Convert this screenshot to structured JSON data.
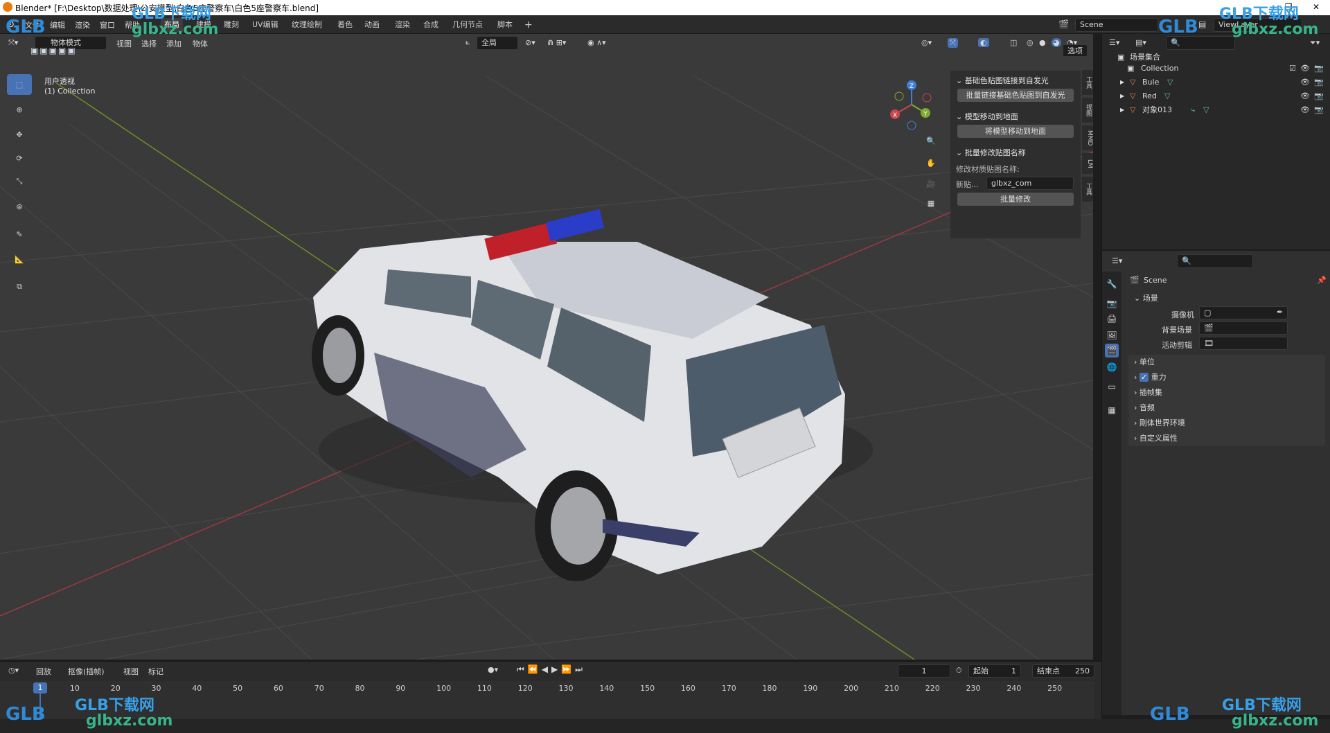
{
  "window": {
    "title": "Blender* [F:\\Desktop\\数据处理\\公安模型\\白色5座警察车\\白色5座警察车.blend]",
    "min": "—",
    "max": "❐",
    "close": "✕"
  },
  "menu": [
    "文件",
    "编辑",
    "渲染",
    "窗口",
    "帮助"
  ],
  "workspaces": [
    "布局",
    "建模",
    "雕刻",
    "UV编辑",
    "纹理绘制",
    "着色",
    "动画",
    "渲染",
    "合成",
    "几何节点",
    "脚本"
  ],
  "workspace_add": "+",
  "scene": {
    "label": "Scene"
  },
  "viewlayer": {
    "label": "ViewLayer"
  },
  "viewport": {
    "mode": "物体模式",
    "menus": [
      "视图",
      "选择",
      "添加",
      "物体"
    ],
    "transform_orientation": "全局",
    "options_label": "选项",
    "perspective_label": "用户透视",
    "collection_label": "(1) Collection",
    "gizmo": {
      "z": "Z",
      "x": "X",
      "y": "Y"
    }
  },
  "npanel": {
    "sections": [
      {
        "title": "基础色贴图链接到自发光",
        "button": "批量链接基础色贴图到自发光"
      },
      {
        "title": "模型移动到地面",
        "button": "将模型移动到地面"
      },
      {
        "title": "批量修改贴图名称",
        "subtitle": "修改材质贴图名称:",
        "field_label": "新贴...",
        "field_value": "glbxz_com",
        "button": "批量修改"
      }
    ],
    "tabs": [
      "工具",
      "视图",
      "MMD",
      "LM",
      "工具"
    ]
  },
  "outliner": {
    "root": "场景集合",
    "collection": "Collection",
    "objects": [
      "Bule",
      "Red",
      "对象013"
    ]
  },
  "properties": {
    "header": "Scene",
    "section_scene": "场景",
    "fields": [
      {
        "label": "摄像机",
        "value": ""
      },
      {
        "label": "背景场景",
        "value": ""
      },
      {
        "label": "活动剪辑",
        "value": ""
      }
    ],
    "panels": [
      "单位",
      "重力",
      "插帧集",
      "音频",
      "刚体世界环境",
      "自定义属性"
    ]
  },
  "timeline": {
    "menus": [
      "回放",
      "抠像(插帧)",
      "视图",
      "标记"
    ],
    "current_frame": "1",
    "start_label": "起始",
    "start_value": "1",
    "end_label": "结束点",
    "end_value": "250",
    "ticks": [
      "1",
      "10",
      "20",
      "30",
      "40",
      "50",
      "60",
      "70",
      "80",
      "90",
      "100",
      "110",
      "120",
      "130",
      "140",
      "150",
      "160",
      "170",
      "180",
      "190",
      "200",
      "210",
      "220",
      "230",
      "240",
      "250"
    ]
  },
  "watermark": {
    "brand": "GLB下载网",
    "url": "glbxz.com",
    "logo": "GLB"
  },
  "colors": {
    "accent": "#4772b3",
    "x_axis": "#c8474f",
    "y_axis": "#7fab2e",
    "z_axis": "#3d7fd6",
    "police_red": "#c0202a",
    "police_blue": "#2a3dc8"
  }
}
